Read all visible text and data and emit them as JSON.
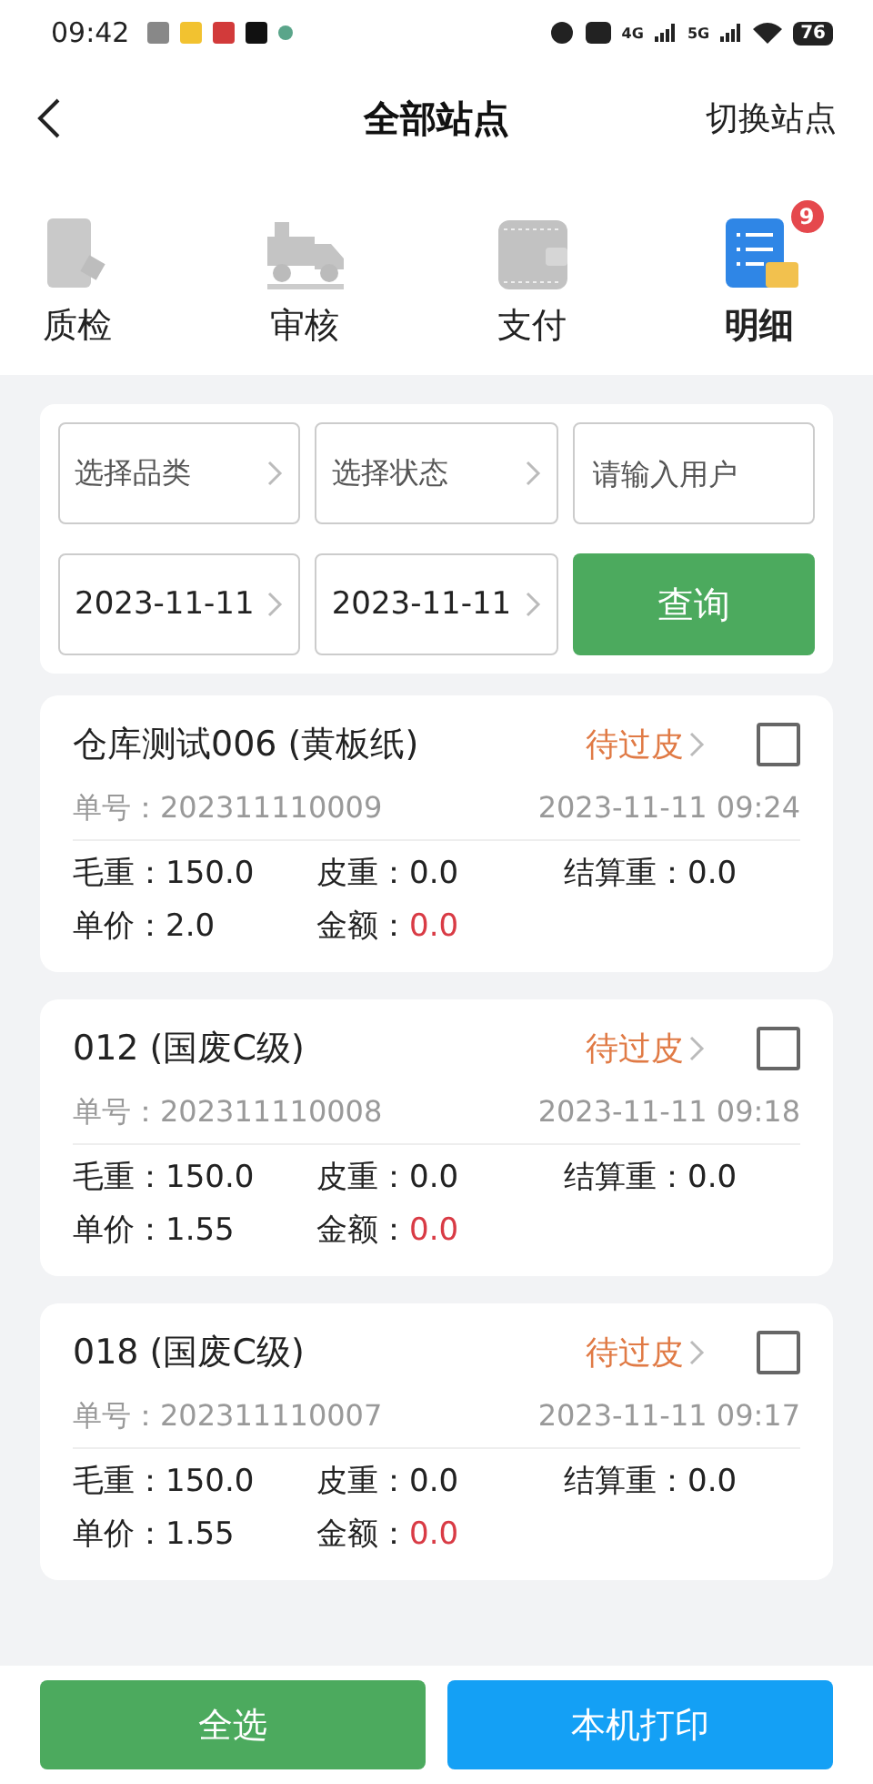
{
  "status_bar": {
    "time": "09:42",
    "network": [
      "4G",
      "5G"
    ],
    "battery": "76"
  },
  "header": {
    "title": "全部站点",
    "action": "切换站点"
  },
  "nav": [
    {
      "label": "质检",
      "kind": "phone",
      "selected": false
    },
    {
      "label": "审核",
      "kind": "truck",
      "selected": false
    },
    {
      "label": "支付",
      "kind": "wallet",
      "selected": false
    },
    {
      "label": "明细",
      "kind": "list",
      "selected": true,
      "badge": "9"
    }
  ],
  "filters": {
    "category": {
      "placeholder": "选择品类"
    },
    "status": {
      "placeholder": "选择状态"
    },
    "user": {
      "placeholder": "请输入用户"
    },
    "start_date": "2023-11-11",
    "end_date": "2023-11-11",
    "search_button": "查询"
  },
  "records": [
    {
      "title": "仓库测试006 (黄板纸)",
      "status": "待过皮",
      "checked": false,
      "order_label": "单号：",
      "order_no": "202311110009",
      "time": "2023-11-11 09:24",
      "fields": [
        {
          "label": "毛重：",
          "value": "150.0",
          "highlight": false
        },
        {
          "label": "皮重：",
          "value": "0.0",
          "highlight": false
        },
        {
          "label": "结算重：",
          "value": "0.0",
          "highlight": false
        },
        {
          "label": "单价：",
          "value": "2.0",
          "highlight": false
        },
        {
          "label": "金额：",
          "value": "0.0",
          "highlight": true
        }
      ]
    },
    {
      "title": "012 (国废C级)",
      "status": "待过皮",
      "checked": false,
      "order_label": "单号：",
      "order_no": "202311110008",
      "time": "2023-11-11 09:18",
      "fields": [
        {
          "label": "毛重：",
          "value": "150.0",
          "highlight": false
        },
        {
          "label": "皮重：",
          "value": "0.0",
          "highlight": false
        },
        {
          "label": "结算重：",
          "value": "0.0",
          "highlight": false
        },
        {
          "label": "单价：",
          "value": "1.55",
          "highlight": false
        },
        {
          "label": "金额：",
          "value": "0.0",
          "highlight": true
        }
      ]
    },
    {
      "title": "018 (国废C级)",
      "status": "待过皮",
      "checked": false,
      "order_label": "单号：",
      "order_no": "202311110007",
      "time": "2023-11-11 09:17",
      "fields": [
        {
          "label": "毛重：",
          "value": "150.0",
          "highlight": false
        },
        {
          "label": "皮重：",
          "value": "0.0",
          "highlight": false
        },
        {
          "label": "结算重：",
          "value": "0.0",
          "highlight": false
        },
        {
          "label": "单价：",
          "value": "1.55",
          "highlight": false
        },
        {
          "label": "金额：",
          "value": "0.0",
          "highlight": true
        }
      ]
    }
  ],
  "bottom_buttons": {
    "select_all": "全选",
    "print": "本机打印"
  }
}
